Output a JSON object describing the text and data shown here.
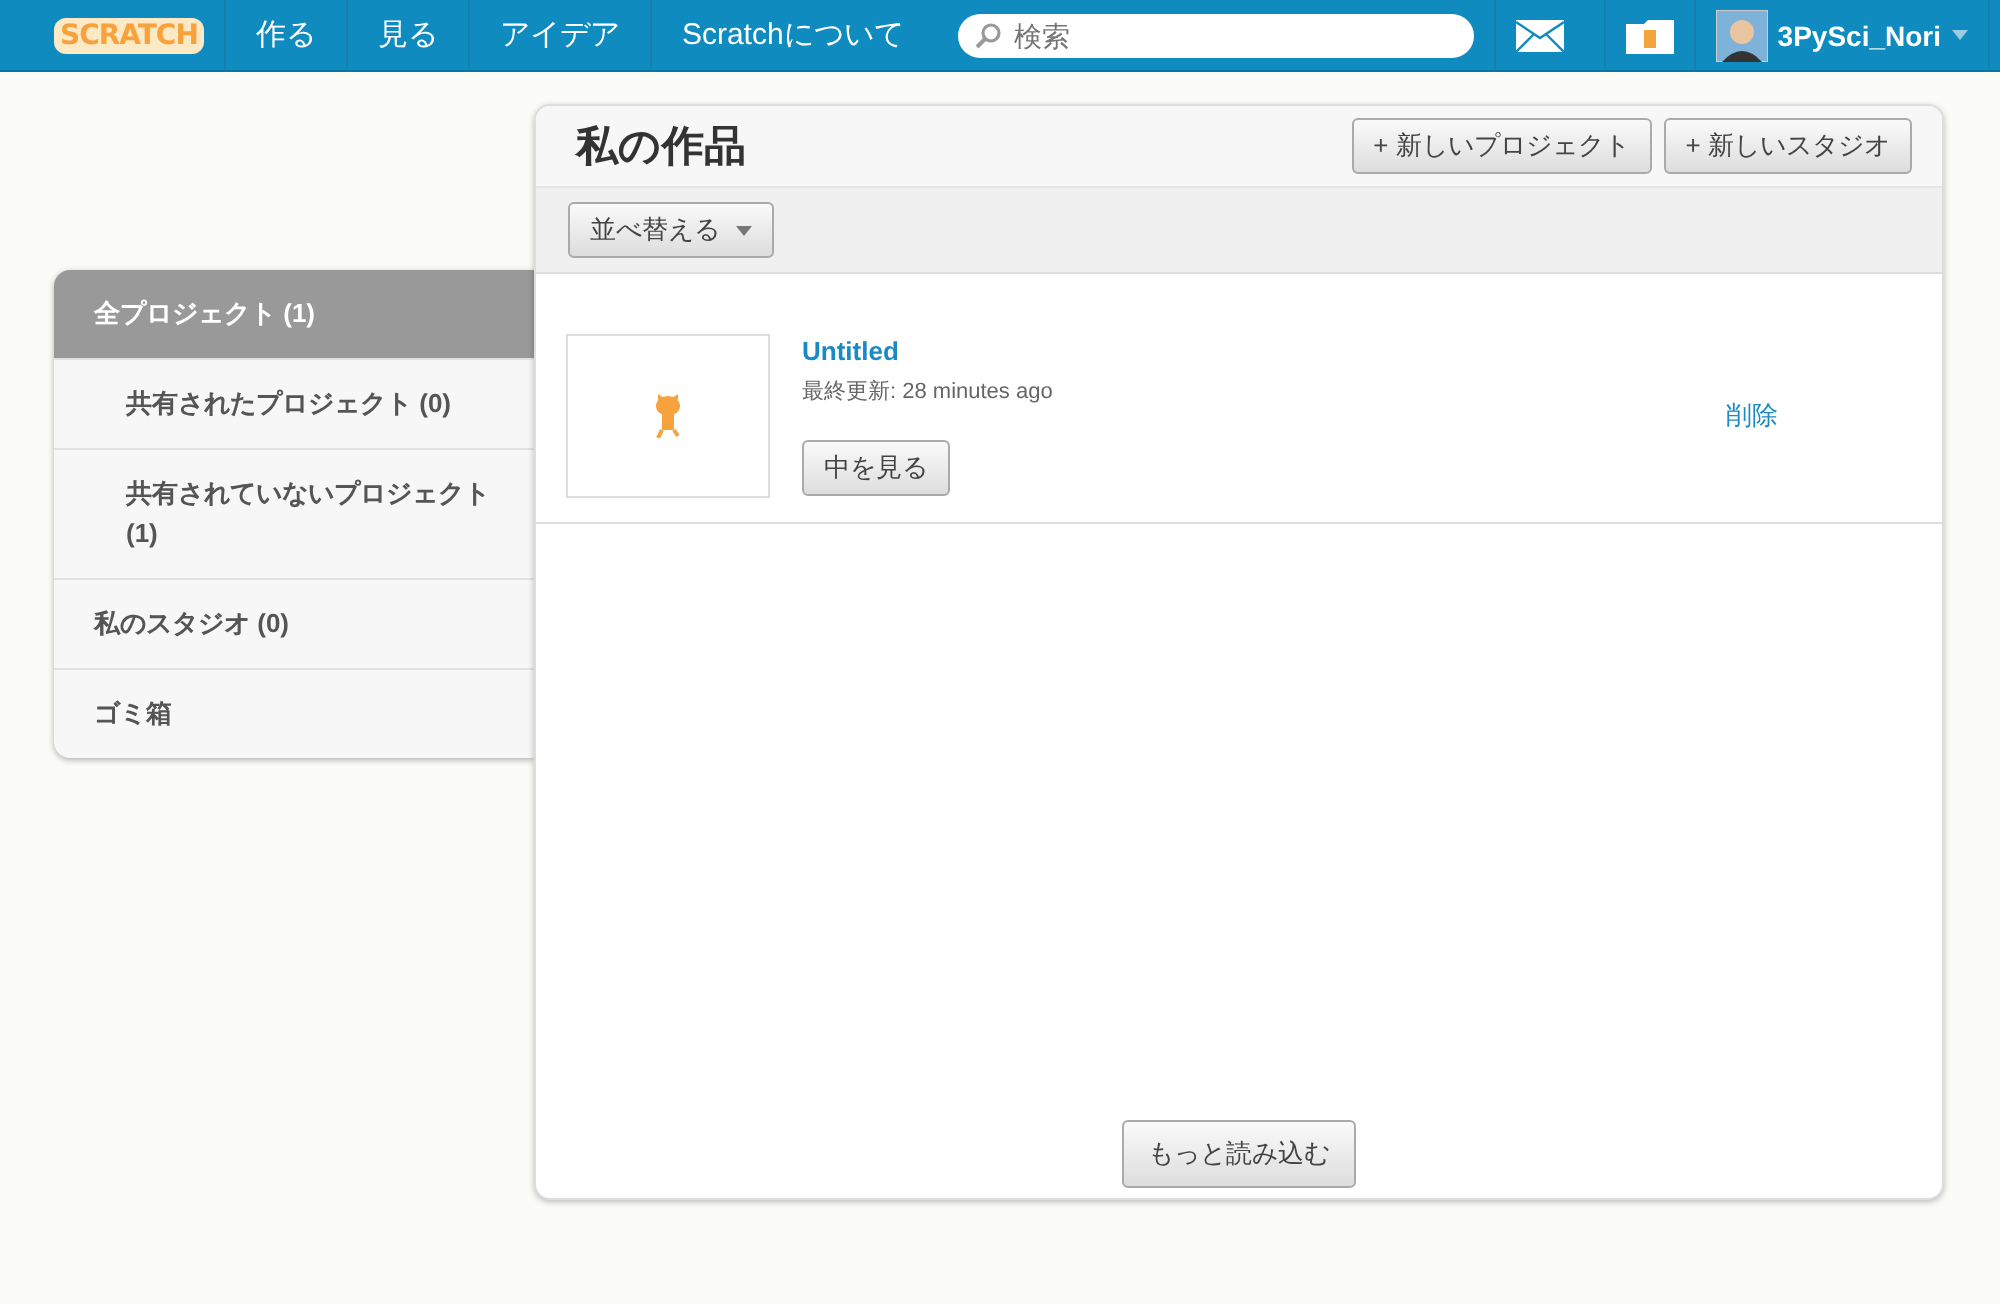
{
  "navbar": {
    "logo": "SCRATCH",
    "links": [
      "作る",
      "見る",
      "アイデア",
      "Scratchについて"
    ],
    "search": {
      "placeholder": "検索"
    },
    "username": "3PySci_Nori"
  },
  "sidebar": {
    "items": [
      {
        "label": "全プロジェクト (1)",
        "selected": true,
        "children": [
          {
            "label": "共有されたプロジェクト (0)",
            "selected": false
          },
          {
            "label": "共有されていないプロジェクト (1)",
            "selected": false
          }
        ]
      },
      {
        "label": "私のスタジオ (0)",
        "selected": false
      },
      {
        "label": "ゴミ箱",
        "selected": false
      }
    ]
  },
  "main": {
    "title": "私の作品",
    "buttons": [
      "+ 新しいプロジェクト",
      "+ 新しいスタジオ"
    ],
    "sort_button": "並べ替える",
    "projects": [
      {
        "title": "Untitled",
        "updated": "最終更新: 28 minutes ago",
        "open_button": "中を見る",
        "delete_link": "削除"
      }
    ],
    "load_more": "もっと読み込む"
  }
}
